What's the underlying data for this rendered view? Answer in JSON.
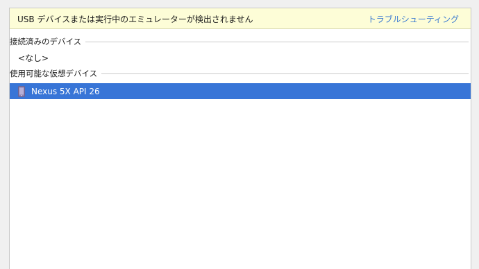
{
  "notice": {
    "message": "USB デバイスまたは実行中のエミュレーターが検出されません",
    "link": "トラブルシューティング"
  },
  "connected": {
    "title": "接続済みのデバイス",
    "empty_label": "<なし>"
  },
  "virtual": {
    "title": "使用可能な仮想デバイス",
    "devices": [
      {
        "label": "Nexus 5X API 26",
        "icon": "phone-icon",
        "selected": true
      }
    ]
  },
  "colors": {
    "selection": "#3875d7",
    "notice_bg": "#fdfdd7",
    "link": "#3b7bd1"
  }
}
